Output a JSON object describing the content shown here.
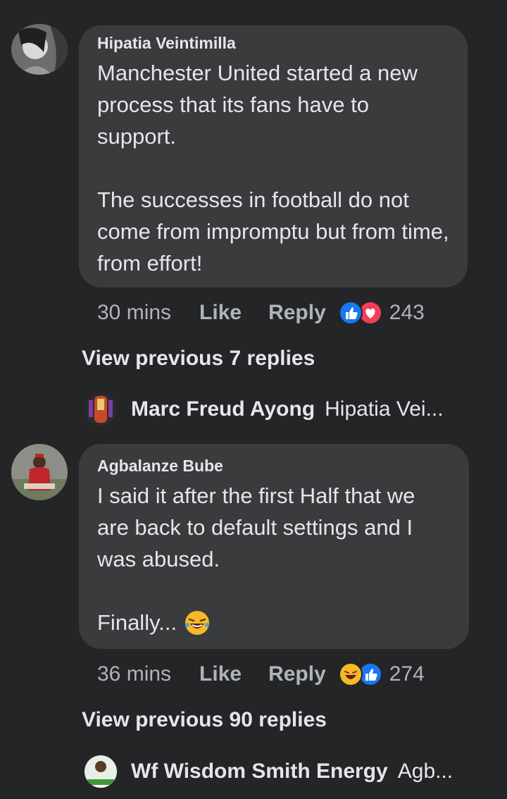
{
  "top_partial_text": "…● … … … … …",
  "comments": [
    {
      "author": "Hipatia Veintimilla",
      "paragraph1": "Manchester United started a new process that its fans have to support.",
      "paragraph2": "The successes in football do not come from impromptu but from time, from effort!",
      "time": "30 mins",
      "like_label": "Like",
      "reply_label": "Reply",
      "reaction_icons": [
        "like-icon",
        "love-icon"
      ],
      "reaction_count": "243",
      "view_previous": "View previous 7 replies",
      "latest_reply": {
        "name": "Marc Freud Ayong",
        "snippet": "Hipatia Vei..."
      }
    },
    {
      "author": "Agbalanze Bube",
      "paragraph1": "I said it after the first Half that we are back to default settings and I was abused.",
      "paragraph2": "Finally...",
      "time": "36 mins",
      "like_label": "Like",
      "reply_label": "Reply",
      "reaction_icons": [
        "haha-icon",
        "like-icon"
      ],
      "reaction_count": "274",
      "view_previous": "View previous 90 replies",
      "latest_reply": {
        "name": "Wf Wisdom Smith Energy",
        "snippet": "Agb..."
      }
    }
  ],
  "colors": {
    "background": "#242526",
    "bubble": "#3a3b3c",
    "text": "#e4e6eb",
    "secondary_text": "#b0b3b8",
    "like_blue": "#1877f2",
    "love_red": "#f33e58",
    "haha_yellow": "#f7b928"
  }
}
